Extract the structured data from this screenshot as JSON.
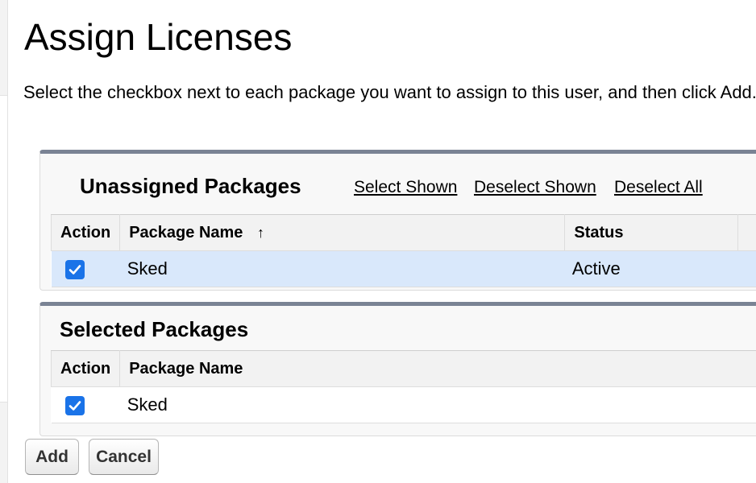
{
  "page": {
    "title": "Assign Licenses",
    "instructions": "Select the checkbox next to each package you want to assign to this user, and then click Add."
  },
  "unassigned": {
    "title": "Unassigned Packages",
    "links": {
      "select_shown": "Select Shown",
      "deselect_shown": "Deselect Shown",
      "deselect_all": "Deselect All"
    },
    "columns": {
      "action": "Action",
      "package_name": "Package Name",
      "sort_indicator": "↑",
      "status": "Status"
    },
    "rows": [
      {
        "checked": true,
        "package_name": "Sked",
        "status": "Active"
      }
    ]
  },
  "selected": {
    "title": "Selected Packages",
    "columns": {
      "action": "Action",
      "package_name": "Package Name"
    },
    "rows": [
      {
        "checked": true,
        "package_name": "Sked"
      }
    ]
  },
  "buttons": {
    "add": "Add",
    "cancel": "Cancel"
  },
  "colors": {
    "checkbox": "#1a73e8",
    "row_highlight": "#d9e8fb",
    "panel_top_border": "#7a8394"
  },
  "icons": {
    "checkbox": "checkmark-icon",
    "sort": "sort-ascending-arrow-icon"
  }
}
